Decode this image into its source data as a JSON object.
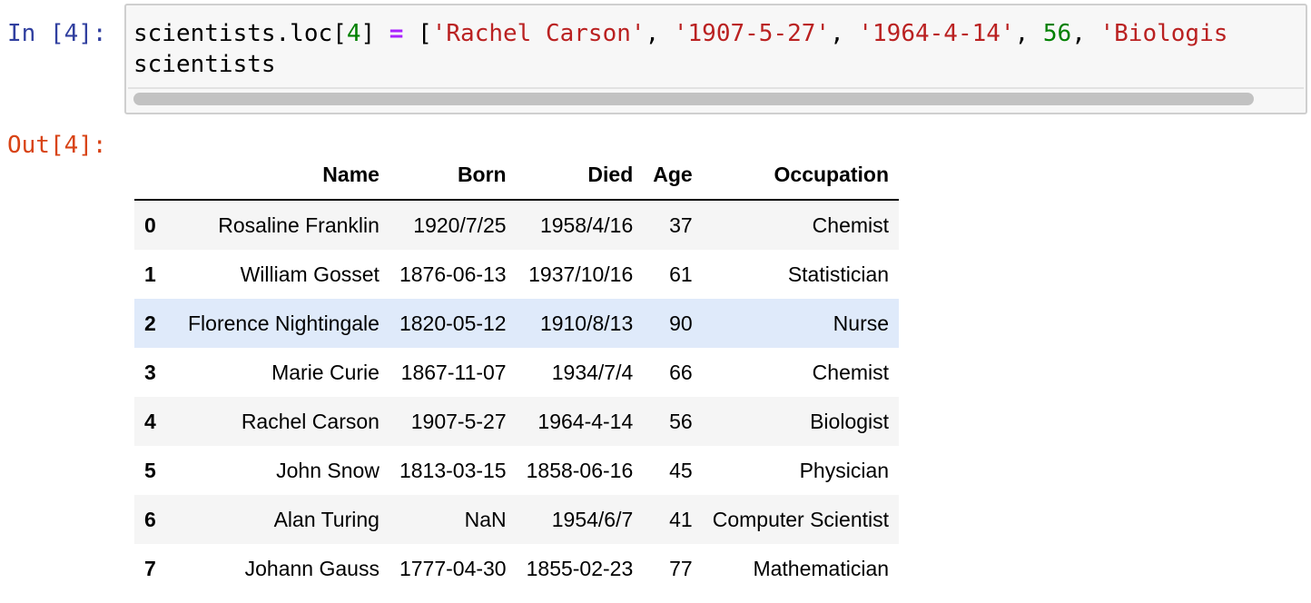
{
  "input_cell": {
    "prompt": "In [4]:",
    "line1": {
      "obj": "scientists.loc[",
      "index": "4",
      "close": "] ",
      "op": "=",
      "open": " [",
      "s1": "'Rachel Carson'",
      "sep1": ", ",
      "s2": "'1907-5-27'",
      "sep2": ", ",
      "s3": "'1964-4-14'",
      "sep3": ", ",
      "n1": "56",
      "sep4": ", ",
      "s4": "'Biologis"
    },
    "line2": "scientists"
  },
  "output_cell": {
    "prompt": "Out[4]:",
    "table": {
      "columns": [
        "Name",
        "Born",
        "Died",
        "Age",
        "Occupation"
      ],
      "rows": [
        {
          "index": "0",
          "name": "Rosaline Franklin",
          "born": "1920/7/25",
          "died": "1958/4/16",
          "age": "37",
          "occupation": "Chemist"
        },
        {
          "index": "1",
          "name": "William Gosset",
          "born": "1876-06-13",
          "died": "1937/10/16",
          "age": "61",
          "occupation": "Statistician"
        },
        {
          "index": "2",
          "name": "Florence Nightingale",
          "born": "1820-05-12",
          "died": "1910/8/13",
          "age": "90",
          "occupation": "Nurse"
        },
        {
          "index": "3",
          "name": "Marie Curie",
          "born": "1867-11-07",
          "died": "1934/7/4",
          "age": "66",
          "occupation": "Chemist"
        },
        {
          "index": "4",
          "name": "Rachel Carson",
          "born": "1907-5-27",
          "died": "1964-4-14",
          "age": "56",
          "occupation": "Biologist"
        },
        {
          "index": "5",
          "name": "John Snow",
          "born": "1813-03-15",
          "died": "1858-06-16",
          "age": "45",
          "occupation": "Physician"
        },
        {
          "index": "6",
          "name": "Alan Turing",
          "born": "NaN",
          "died": "1954/6/7",
          "age": "41",
          "occupation": "Computer Scientist"
        },
        {
          "index": "7",
          "name": "Johann Gauss",
          "born": "1777-04-30",
          "died": "1855-02-23",
          "age": "77",
          "occupation": "Mathematician"
        }
      ]
    }
  },
  "colors": {
    "in_prompt": "#303F9F",
    "out_prompt": "#D84315",
    "keyword": "#AA22FF",
    "number": "#008000",
    "string": "#BA2121",
    "row_hover": "#dfeafa"
  }
}
